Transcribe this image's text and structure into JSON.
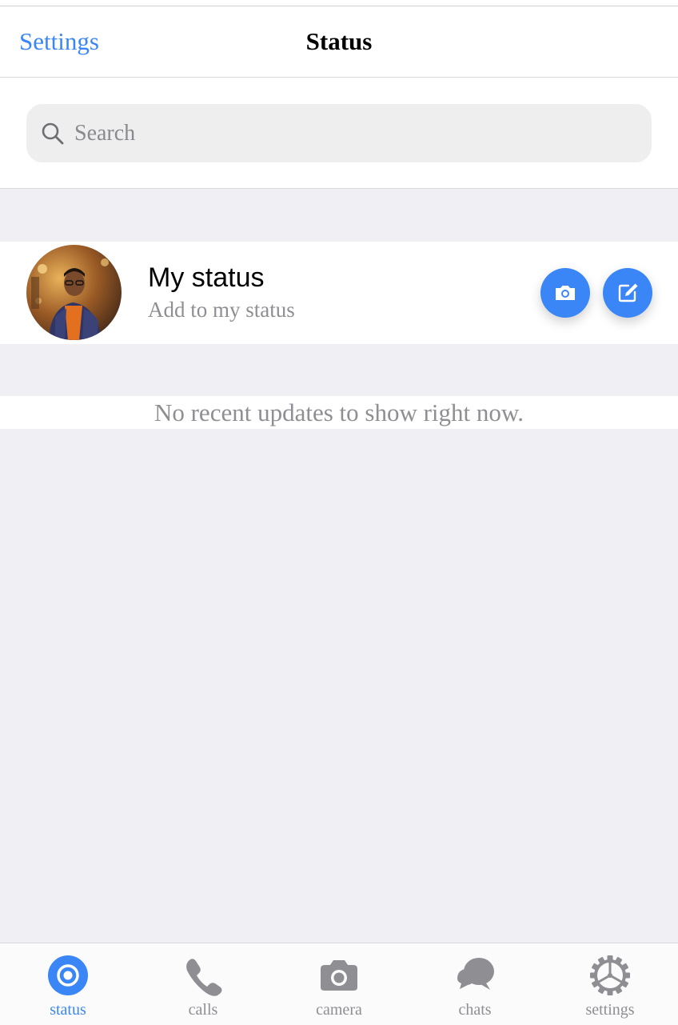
{
  "navbar": {
    "back_label": "Settings",
    "title": "Status"
  },
  "search": {
    "placeholder": "Search"
  },
  "my_status": {
    "title": "My status",
    "subtitle": "Add to my status"
  },
  "empty_message": "No recent updates to show right now.",
  "tabs": [
    {
      "label": "status",
      "icon": "status-icon",
      "active": true
    },
    {
      "label": "calls",
      "icon": "phone-icon",
      "active": false
    },
    {
      "label": "camera",
      "icon": "camera-icon",
      "active": false
    },
    {
      "label": "chats",
      "icon": "chat-bubbles-icon",
      "active": false
    },
    {
      "label": "settings",
      "icon": "gear-icon",
      "active": false
    }
  ],
  "colors": {
    "accent": "#3b86f7",
    "background": "#efeff4",
    "secondary_text": "#8e8e93",
    "icon_gray": "#8e8e93"
  }
}
